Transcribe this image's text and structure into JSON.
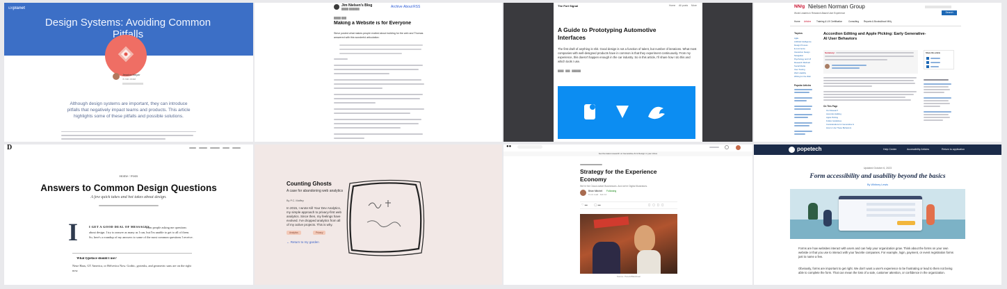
{
  "tiles": {
    "t1": {
      "title": "Design Systems: Avoiding Common Pitfalls",
      "author": "Jessica Meyer",
      "meta": "3 min read",
      "lead": "Although design systems are important, they can introduce pitfalls that negatively impact teams and products. This article highlights some of these pitfalls and possible solutions."
    },
    "t2": {
      "site": "Jim Nielsen's Blog",
      "nav": [
        "Archive",
        "About",
        "RSS"
      ],
      "title": "Making a Website is for Everyone",
      "intro": "Steve posted what makes people excited about building for the web and Thomas answered with this wonderful articulation:"
    },
    "t3": {
      "brand": "The Fort Signal",
      "nav": [
        "Home",
        "All posts",
        "More"
      ],
      "title": "A Guide to Prototyping Automotive Interfaces",
      "lead": "The first draft of anything is shit. Good design is not a function of talent, but number of iterations. What most companies with well-designed products have in common is that they experiment continuously. From my experience, this doesn't happen enough in the car industry. So in this article, I'll share how I do this and which tools I use."
    },
    "t4": {
      "brand": "Nielsen Norman Group",
      "tagline": "World Leaders in Research-Based User Experience",
      "nav": [
        "Home",
        "Articles",
        "Training & UX Certification",
        "Consulting",
        "Reports & Books",
        "About NN/g"
      ],
      "search_label": "Search",
      "sidebar_title": "Topics",
      "topics": [
        "Agile",
        "Artificial Intelligence",
        "Design Process",
        "E-commerce",
        "Interaction Design",
        "Navigation",
        "Psychology and UX",
        "Research Methods",
        "Social Media",
        "User Testing",
        "Web Usability",
        "Writing for the Web"
      ],
      "title": "Accordion Editing and Apple Picking: Early Generative-AI User Behaviors",
      "summary_label": "Summary:",
      "toc_title": "On This Page",
      "toc": [
        "Our Research",
        "Accordion Editing",
        "Apple Picking",
        "Follow Guidelines",
        "Considerations for Generative AI",
        "How to Use These Behaviors"
      ],
      "share_label": "Share this article",
      "related_title": "Popular Articles"
    },
    "t5": {
      "brand": "D",
      "crumbs": "Home / Posts",
      "title": "Answers to Common Design Questions",
      "subtitle": "A few quick takes and hot takes about design.",
      "drop_cap": "I",
      "intro_caps": "I GET A GOOD DEAL OF MESSAGES",
      "intro": "from people asking me questions about design. I try to answer as many as I can, but I'm unable to get to all of them. So, here's a roundup of my answers to some of the most common questions I receive.",
      "q_heading": "What typeface should I use?",
      "q_text": "Neue Haas, GT America, or Helvetica Now. Gothic, grotesks, and geometric sans are on the right now."
    },
    "t6": {
      "title": "Counting Ghosts",
      "subtitle": "A case for abandoning web analytics",
      "byline": "By P.C. Maffey",
      "body": "In 2015, I wrote Kill Your Dev Analytics, my simple approach to privacy-first web analytics. Since then, my feelings have evolved. I've dropped analytics from all of my active projects. This is why.",
      "tags": [
        "Analytics",
        "Privacy"
      ],
      "back_link": "← Return to my garden"
    },
    "t7": {
      "banner": "Get the latest research on Generative AI & Design in your inbox",
      "title": "Strategy for the Experience Economy",
      "subtitle": "We're the Cloud-native Businesses. And we're Digital Illustrators.",
      "author": "Brian Mitchell",
      "follow": "Following",
      "meta": "6 min read · Feb 14",
      "caption": "Source: Pexels/Blackbear"
    },
    "t8": {
      "brand": "popetech",
      "nav": [
        "Help Center",
        "Accessibility Articles",
        "Return to application"
      ],
      "date": "Updated October 6, 2023",
      "title": "Form accessibility and usability beyond the basics",
      "byline": "By Whitney Lewis",
      "body1": "Forms are how websites interact with users and can help your organization grow. Think about the forms on your own website or that you use to interact with your favorite companies. For example, login, payment, or event registration forms just to name a few.",
      "body2": "Obviously, forms are important to get right. We don't want a user's experience to be frustrating or lead to them not being able to complete the form. That can mean the loss of a sale, customer attention, or confidence in the organization."
    }
  },
  "colors": {
    "nng_red": "#c8102e",
    "pope_navy": "#1b2b49",
    "fort_blue": "#0c8df2",
    "accent_coral": "#e96a59"
  }
}
